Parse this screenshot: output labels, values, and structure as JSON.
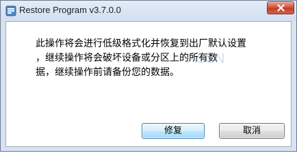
{
  "window": {
    "title": "Restore Program v3.7.0.0"
  },
  "message": {
    "line1": "此操作将会进行低级格式化并恢复到出厂默认设置",
    "line2": "，继续操作将会破坏设备或分区上的所有数",
    "line3": "据，继续操作前请备份您的数据。"
  },
  "watermark": "ASSN",
  "buttons": {
    "restore_label": "修复",
    "cancel_label": "取消"
  },
  "icons": {
    "app": "app-icon",
    "close": "close-icon"
  },
  "colors": {
    "frame": "#d7e3f1",
    "close_button": "#c33b22",
    "default_button_border": "#3c7fb1"
  }
}
